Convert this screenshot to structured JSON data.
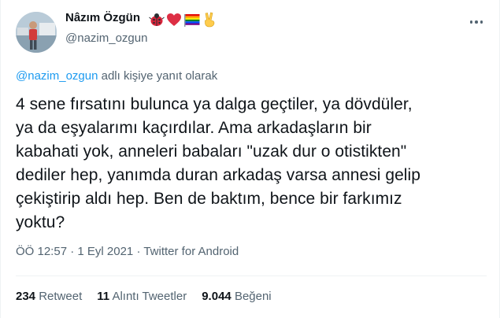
{
  "author": {
    "name": "Nâzım Özgün",
    "handle": "@nazim_ozgun"
  },
  "reply": {
    "mention": "@nazim_ozgun",
    "suffix": " adlı kişiye yanıt olarak"
  },
  "tweet": {
    "lines": [
      "4 sene fırsatını bulunca ya dalga geçtiler, ya dövdüler,",
      "ya da eşyalarımı kaçırdılar. Ama arkadaşların bir",
      "kabahati yok, anneleri babaları \"uzak dur o otistikten\"",
      "dediler hep, yanımda duran arkadaş varsa annesi gelip",
      "çekiştirip aldı hep. Ben de baktım, bence bir farkımız",
      "yoktu?"
    ]
  },
  "meta": {
    "time": "ÖÖ 12:57",
    "separator": " · ",
    "date": "1 Eyl 2021",
    "source": "Twitter for Android"
  },
  "stats": {
    "retweets_count": "234",
    "retweets_label": "Retweet",
    "quotes_count": "11",
    "quotes_label": "Alıntı Tweetler",
    "likes_count": "9.044",
    "likes_label": "Beğeni"
  },
  "icons": {
    "name_emojis": [
      "ladybug-icon",
      "heart-icon",
      "rainbow-flag-icon",
      "victory-hand-icon"
    ],
    "more": "more-icon"
  },
  "colors": {
    "accent": "#1d9bf0",
    "text": "#0f1419",
    "secondary": "#536471",
    "border": "#eff3f4"
  }
}
